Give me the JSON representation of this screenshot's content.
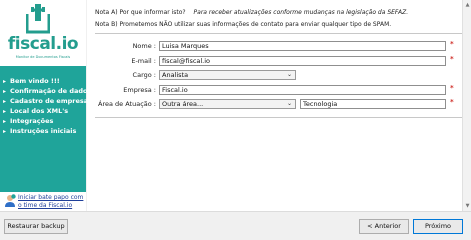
{
  "brand": {
    "name": "fiscal.io",
    "tagline": "Monitor de Documentos Fiscais",
    "color": "#239d8e"
  },
  "sidebar": {
    "accent": "#1fa49a",
    "items": [
      {
        "label": "Bem vindo !!!",
        "icon": "arrow-right-icon"
      },
      {
        "label": "Confirmação de dados",
        "icon": "arrow-right-icon"
      },
      {
        "label": "Cadastro de empresas",
        "icon": "arrow-right-icon"
      },
      {
        "label": "Local dos XML's",
        "icon": "arrow-right-icon"
      },
      {
        "label": "Integrações",
        "icon": "arrow-right-icon"
      },
      {
        "label": "Instruções iniciais",
        "icon": "arrow-right-icon"
      }
    ],
    "chat": {
      "line1": "Iniciar bate papo com",
      "line2": "o time da Fiscal.io",
      "icon": "chat-person-icon"
    }
  },
  "notes": {
    "a_label": "Nota A) Por que informar isto?",
    "a_reason": "Para receber atualizações conforme mudanças na legislação da SEFAZ.",
    "b_text": "Nota B) Prometemos NÃO utilizar suas informações de contato para enviar qualquer tipo de SPAM."
  },
  "form": {
    "nome": {
      "label": "Nome :",
      "value": "Luisa Marques"
    },
    "email": {
      "label": "E-mail :",
      "value": "fiscal@fiscal.io"
    },
    "cargo": {
      "label": "Cargo :",
      "value": "Analista"
    },
    "empresa": {
      "label": "Empresa :",
      "value": "Fiscal.io"
    },
    "area": {
      "label": "Área de Atuação :",
      "value": "Outra área...",
      "other_value": "Tecnologia"
    },
    "required_mark": "*"
  },
  "footer": {
    "restore_label": "Restaurar backup",
    "back_label": "< Anterior",
    "next_label": "Próximo"
  }
}
